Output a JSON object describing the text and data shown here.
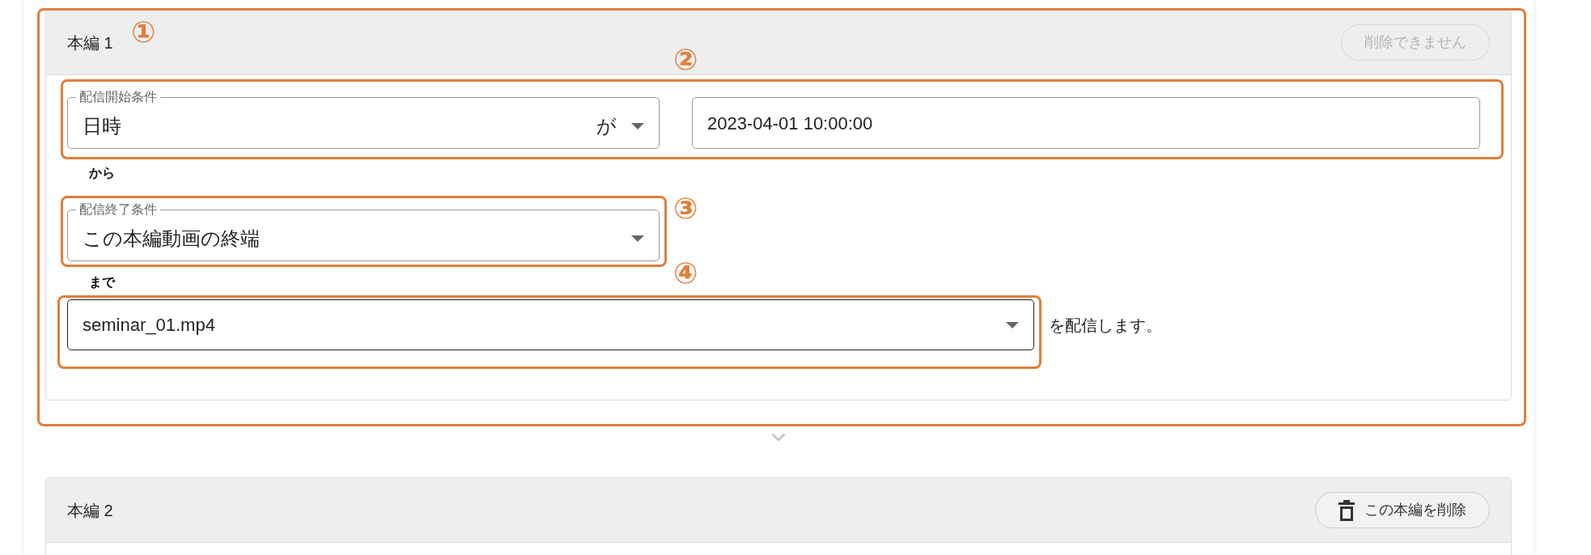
{
  "sections": [
    {
      "title": "本編 1",
      "delete_button": {
        "label": "削除できません",
        "disabled": true
      },
      "start_condition": {
        "label": "配信開始条件",
        "value": "日時",
        "suffix": "が"
      },
      "start_datetime": {
        "value": "2023-04-01 10:00:00"
      },
      "from_text": "から",
      "end_condition": {
        "label": "配信終了条件",
        "value": "この本編動画の終端"
      },
      "until_text": "まで",
      "video": {
        "value": "seminar_01.mp4"
      },
      "trailing_text": "を配信します。"
    },
    {
      "title": "本編 2",
      "delete_button": {
        "label": "この本編を削除",
        "disabled": false
      }
    }
  ],
  "annotations": [
    {
      "label": "①"
    },
    {
      "label": "②"
    },
    {
      "label": "③"
    },
    {
      "label": "④"
    }
  ]
}
